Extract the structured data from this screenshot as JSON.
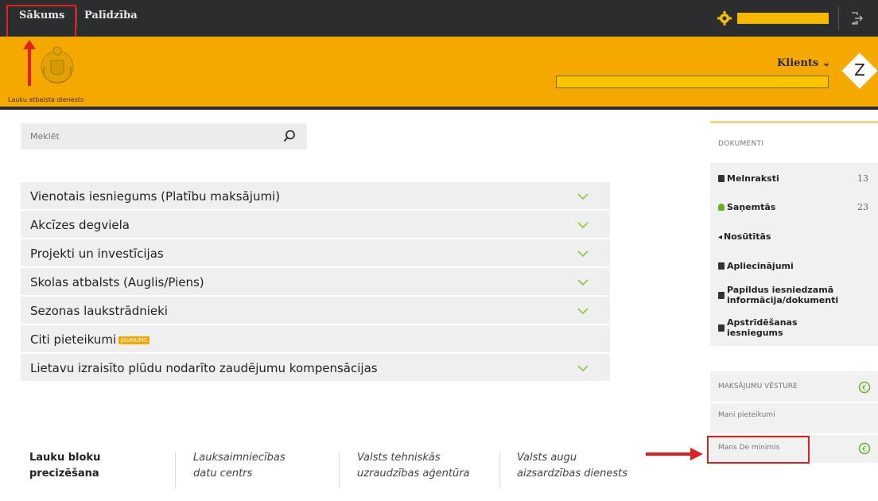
{
  "topbar": {
    "home_label": "Sākums",
    "help_label": "Palīdzība"
  },
  "header": {
    "org_name": "Lauku atbalsta dienests",
    "client_label": "Klients ⌄",
    "badge_letter": "Z"
  },
  "search": {
    "placeholder": "Meklēt"
  },
  "accordion": {
    "items": [
      {
        "label": "Vienotais iesniegums (Platību maksājumi)"
      },
      {
        "label": "Akcīzes degviela"
      },
      {
        "label": "Projekti un investīcijas"
      },
      {
        "label": "Skolas atbalsts (Auglis/Piens)"
      },
      {
        "label": "Sezonas laukstrādnieki"
      },
      {
        "label": "Citi pieteikumi",
        "badge": "JAUNUMS"
      },
      {
        "label": "Lietavu izraisīto plūdu nodarīto zaudējumu kompensācijas"
      }
    ]
  },
  "links": [
    {
      "line1": "Lauku bloku",
      "line2": "precizēšana"
    },
    {
      "line1": "Lauksaimniecības",
      "line2": "datu centrs"
    },
    {
      "line1": "Valsts tehniskās",
      "line2": "uzraudzības aģentūra"
    },
    {
      "line1": "Valsts augu",
      "line2": "aizsardzības dienests"
    }
  ],
  "documents": {
    "title": "DOKUMENTI",
    "items": [
      {
        "label": "Melnraksti",
        "count": "13"
      },
      {
        "label": "Saņemtās",
        "count": "23"
      },
      {
        "label": "Nosūtītās"
      },
      {
        "label": "Apliecinājumi"
      },
      {
        "line1": "Papildus iesniedzamā",
        "line2": "informācija/dokumenti"
      },
      {
        "line1": "Apstrīdēšanas",
        "line2": "iesniegums"
      }
    ]
  },
  "payments": {
    "title": "MAKSĀJUMU VĒSTURE",
    "items": [
      {
        "label": "Mani pieteikumi"
      },
      {
        "label": "Mans De minimis"
      }
    ]
  },
  "colors": {
    "topbar": "#2b2d2f",
    "brand_yellow": "#f5a800",
    "highlight_red": "#e32020"
  }
}
